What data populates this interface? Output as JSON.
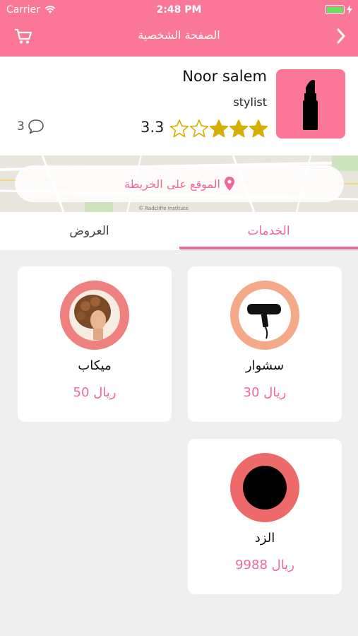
{
  "status_bar": {
    "carrier": "Carrier",
    "time": "2:48 PM"
  },
  "nav": {
    "title": "الصفحة الشخصية",
    "left_icon": "cart-icon",
    "right_icon": "chevron-right-icon"
  },
  "profile": {
    "name": "Noor salem",
    "role": "stylist",
    "rating": "3.3",
    "comments_count": "3",
    "stars_filled": 3,
    "stars_total": 5,
    "avatar_icon": "lipstick-icon"
  },
  "map": {
    "button_label": "الموقع على الخريطة",
    "credit": "© Radcliffe Institute"
  },
  "tabs": [
    {
      "label": "الخدمات",
      "active": true
    },
    {
      "label": "العروض",
      "active": false
    }
  ],
  "services": [
    {
      "name": "سشوار",
      "price": "30 ريال",
      "icon": "hair-dryer-icon",
      "ring_color": "#f4a989"
    },
    {
      "name": "ميكاب",
      "price": "50 ريال",
      "icon": "hairstyle-photo",
      "ring_color": "#ef8080"
    },
    {
      "name": "الزد",
      "price": "9988 ريال",
      "icon": "black-circle-icon",
      "ring_color": "#ee6a6a"
    }
  ],
  "colors": {
    "primary": "#fb7797",
    "accent": "#f0689a",
    "star": "#d6ae00",
    "background": "#efefef"
  }
}
